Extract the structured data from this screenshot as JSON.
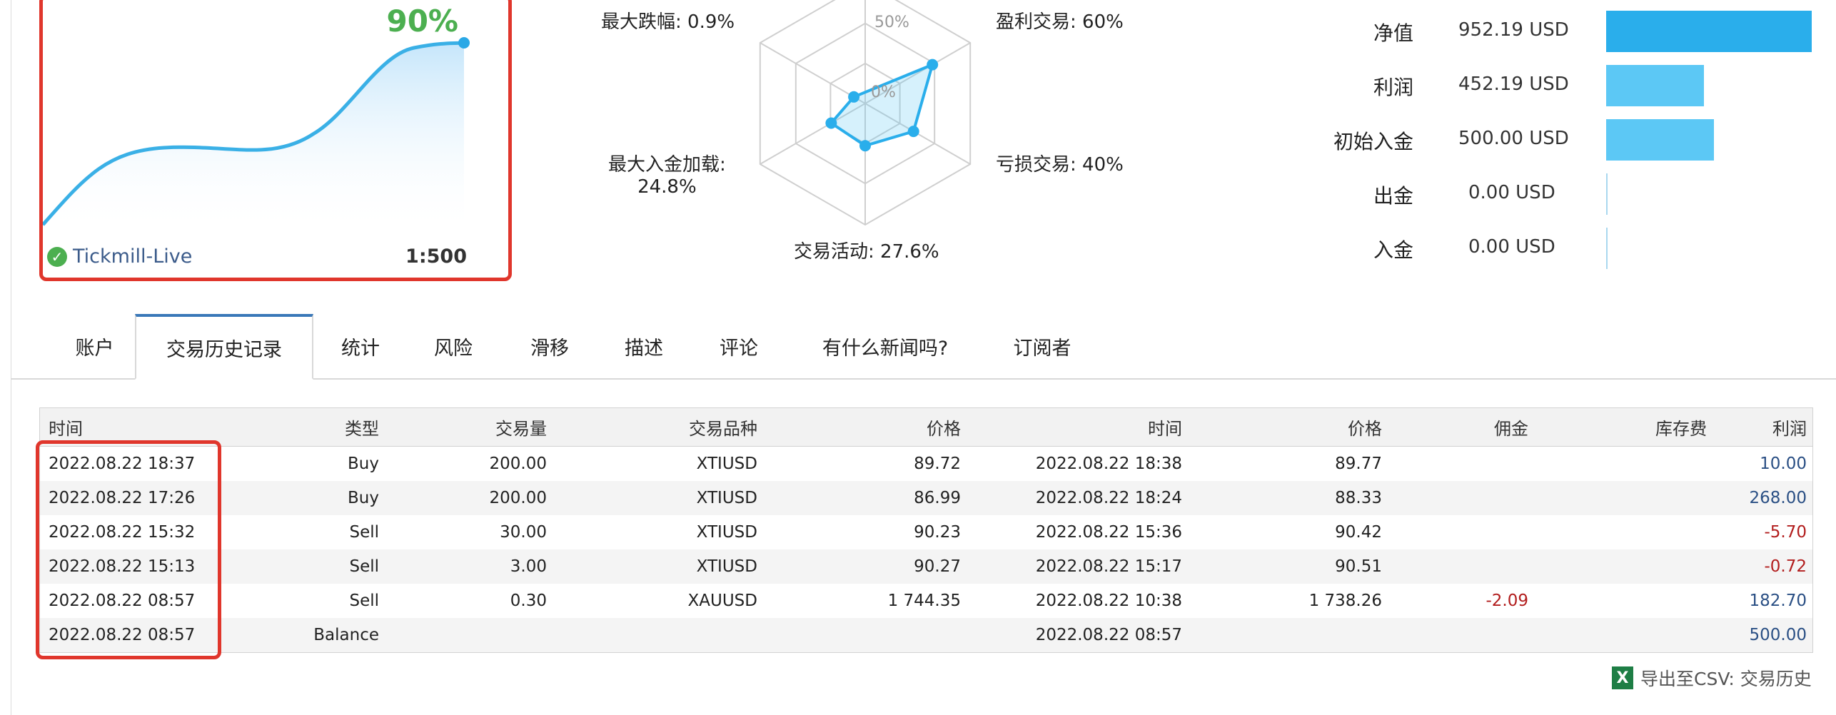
{
  "growth_card": {
    "growth_pct": "90%",
    "account_name": "Tickmill-Live",
    "leverage": "1:500"
  },
  "radar": {
    "ring_labels": [
      "50%",
      "0%"
    ],
    "labels": {
      "max_drawdown": "最大跌幅: 0.9%",
      "profit_trades": "盈利交易: 60%",
      "max_deposit_load_line1": "最大入金加载:",
      "max_deposit_load_line2": "24.8%",
      "loss_trades": "亏损交易: 40%",
      "trading_activity": "交易活动: 27.6%"
    },
    "values": {
      "max_drawdown": 0.9,
      "profit_trades": 60,
      "loss_trades": 40,
      "trading_activity": 27.6,
      "max_deposit_load": 24.8
    }
  },
  "summary": [
    {
      "label": "净值",
      "value": "952.19 USD",
      "bar_value": 952.19
    },
    {
      "label": "利润",
      "value": "452.19 USD",
      "bar_value": 452.19
    },
    {
      "label": "初始入金",
      "value": "500.00 USD",
      "bar_value": 500.0
    },
    {
      "label": "出金",
      "value": "0.00 USD",
      "bar_value": 0
    },
    {
      "label": "入金",
      "value": "0.00 USD",
      "bar_value": 0
    }
  ],
  "tabs": [
    "账户",
    "交易历史记录",
    "统计",
    "风险",
    "滑移",
    "描述",
    "评论",
    "有什么新闻吗?",
    "订阅者"
  ],
  "active_tab": "交易历史记录",
  "table": {
    "headers": [
      "时间",
      "类型",
      "交易量",
      "交易品种",
      "价格",
      "时间",
      "价格",
      "佣金",
      "库存费",
      "利润"
    ],
    "rows": [
      [
        "2022.08.22 18:37",
        "Buy",
        "200.00",
        "XTIUSD",
        "89.72",
        "2022.08.22 18:38",
        "89.77",
        "",
        "",
        "10.00"
      ],
      [
        "2022.08.22 17:26",
        "Buy",
        "200.00",
        "XTIUSD",
        "86.99",
        "2022.08.22 18:24",
        "88.33",
        "",
        "",
        "268.00"
      ],
      [
        "2022.08.22 15:32",
        "Sell",
        "30.00",
        "XTIUSD",
        "90.23",
        "2022.08.22 15:36",
        "90.42",
        "",
        "",
        "-5.70"
      ],
      [
        "2022.08.22 15:13",
        "Sell",
        "3.00",
        "XTIUSD",
        "90.27",
        "2022.08.22 15:17",
        "90.51",
        "",
        "",
        "-0.72"
      ],
      [
        "2022.08.22 08:57",
        "Sell",
        "0.30",
        "XAUUSD",
        "1 744.35",
        "2022.08.22 10:38",
        "1 738.26",
        "-2.09",
        "",
        "182.70"
      ],
      [
        "2022.08.22 08:57",
        "Balance",
        "",
        "",
        "",
        "2022.08.22 08:57",
        "",
        "",
        "",
        "500.00"
      ]
    ]
  },
  "export": {
    "icon": "excel-icon",
    "label": "导出至CSV: 交易历史"
  },
  "colors": {
    "highlight_border": "#e0362c",
    "growth_green": "#4caf50",
    "line_blue": "#3ab0e6",
    "tab_active": "#3a78b8",
    "negative": "#b21d1d",
    "positive": "#2a4f84"
  }
}
